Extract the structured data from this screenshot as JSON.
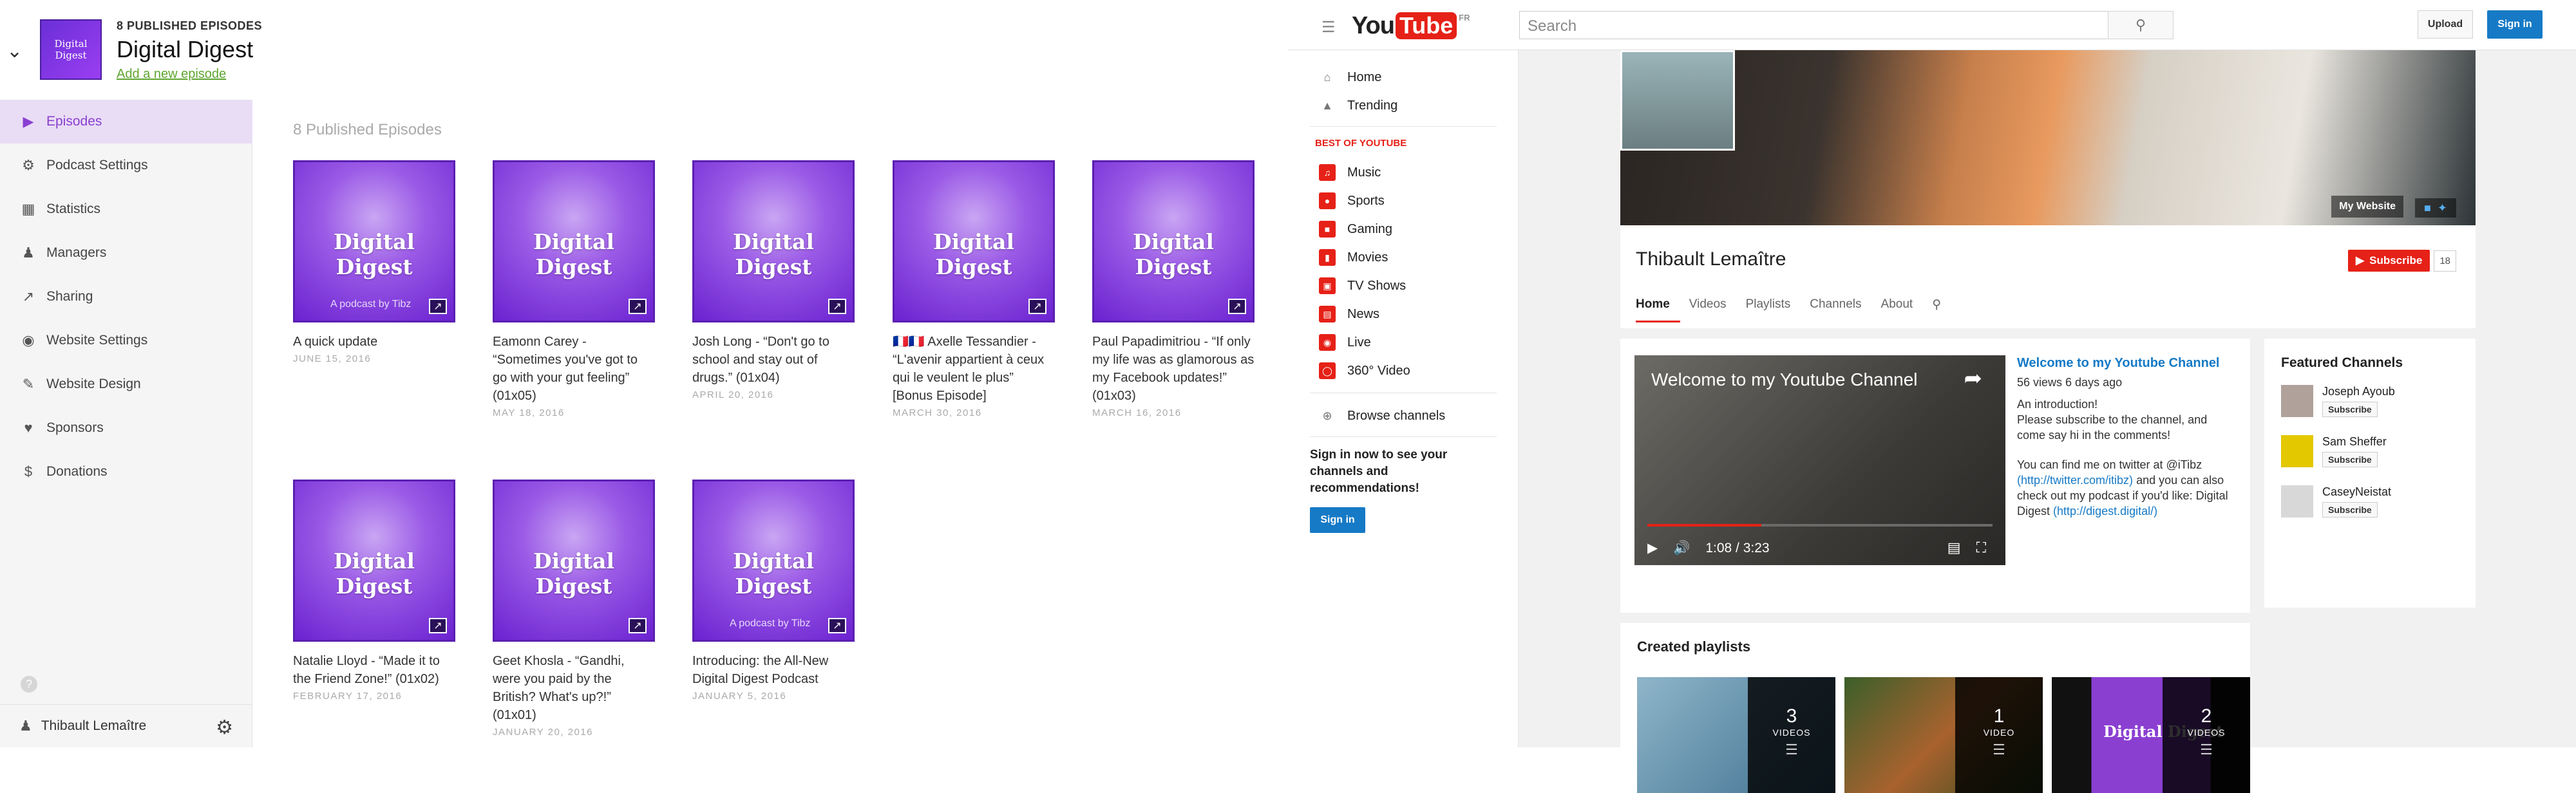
{
  "podcast": {
    "published_count": "8 PUBLISHED EPISODES",
    "title": "Digital Digest",
    "add_episode": "Add a new episode",
    "thumb_label": "Digital Digest"
  },
  "sidebar": {
    "items": [
      {
        "label": "Episodes",
        "icon": "play-circle-icon"
      },
      {
        "label": "Podcast Settings",
        "icon": "gear-icon"
      },
      {
        "label": "Statistics",
        "icon": "bar-chart-icon"
      },
      {
        "label": "Managers",
        "icon": "users-icon"
      },
      {
        "label": "Sharing",
        "icon": "share-icon"
      },
      {
        "label": "Website Settings",
        "icon": "globe-icon"
      },
      {
        "label": "Website Design",
        "icon": "brush-icon"
      },
      {
        "label": "Sponsors",
        "icon": "heart-icon"
      },
      {
        "label": "Donations",
        "icon": "dollar-icon"
      }
    ],
    "help": "?",
    "user_name": "Thibault Lemaître"
  },
  "main": {
    "heading": "8 Published Episodes",
    "art_label": "Digital Digest",
    "art_tag": "A podcast by Tibz",
    "episodes": [
      {
        "title": "A quick update",
        "date": "JUNE 15, 2016"
      },
      {
        "title": "Eamonn Carey - “Sometimes you've got to go with your gut feeling” (01x05)",
        "date": "MAY 18, 2016"
      },
      {
        "title": "Josh Long - “Don't go to school and stay out of drugs.” (01x04)",
        "date": "APRIL 20, 2016"
      },
      {
        "title": "🇫🇷🇫🇷 Axelle Tessandier - “L'avenir appartient à ceux qui le veulent le plus” [Bonus Episode]",
        "date": "MARCH 30, 2016"
      },
      {
        "title": "Paul Papadimitriou - “If only my life was as glamorous as my Facebook updates!” (01x03)",
        "date": "MARCH 16, 2016"
      },
      {
        "title": "Natalie Lloyd - “Made it to the Friend Zone!” (01x02)",
        "date": "FEBRUARY 17, 2016"
      },
      {
        "title": "Geet Khosla - “Gandhi, were you paid by the British? What's up?!” (01x01)",
        "date": "JANUARY 20, 2016"
      },
      {
        "title": "Introducing: the All-New Digital Digest Podcast",
        "date": "JANUARY 5, 2016"
      }
    ]
  },
  "youtube": {
    "logo_you": "You",
    "logo_tube": "Tube",
    "logo_country": "FR",
    "search_placeholder": "Search",
    "upload": "Upload",
    "signin": "Sign in",
    "nav": [
      {
        "label": "Home",
        "icon": "home-icon"
      },
      {
        "label": "Trending",
        "icon": "flame-icon"
      }
    ],
    "best_heading": "BEST OF YOUTUBE",
    "best": [
      {
        "label": "Music"
      },
      {
        "label": "Sports"
      },
      {
        "label": "Gaming"
      },
      {
        "label": "Movies"
      },
      {
        "label": "TV Shows"
      },
      {
        "label": "News"
      },
      {
        "label": "Live"
      },
      {
        "label": "360° Video"
      }
    ],
    "browse": "Browse channels",
    "signin_msg": "Sign in now to see your channels and recommendations!",
    "signin2": "Sign in",
    "channel": {
      "name": "Thibault Lemaître",
      "website": "My Website",
      "subscribe": "Subscribe",
      "subscriber_count": "18",
      "tabs": [
        "Home",
        "Videos",
        "Playlists",
        "Channels",
        "About"
      ],
      "video": {
        "title": "Welcome to my Youtube Channel",
        "time": "1:08 / 3:23",
        "progress": 0.33,
        "info_title": "Welcome to my Youtube Channel",
        "meta": "56 views  6 days ago",
        "line1": "An introduction!",
        "line2": "Please subscribe to the channel, and come say hi in the comments!",
        "line3": "You can find me on twitter at @iTibz",
        "link1": "(http://twitter.com/itibz)",
        "line4": "and you can also check out my podcast if you'd like: Digital Digest",
        "link2": "(http://digest.digital/)"
      },
      "featured_title": "Featured Channels",
      "featured": [
        {
          "name": "Joseph Ayoub",
          "btn": "Subscribe"
        },
        {
          "name": "Sam Sheffer",
          "btn": "Subscribe"
        },
        {
          "name": "CaseyNeistat",
          "btn": "Subscribe"
        }
      ],
      "playlists_title": "Created playlists",
      "playlists": [
        {
          "count": "3",
          "label": "VIDEOS"
        },
        {
          "count": "1",
          "label": "VIDEO"
        },
        {
          "count": "2",
          "label": "VIDEOS"
        }
      ]
    }
  },
  "colors": {
    "accent_purple": "#8a3fd1",
    "green_link": "#5fa531",
    "yt_red": "#e62117",
    "yt_blue": "#167ac6"
  }
}
